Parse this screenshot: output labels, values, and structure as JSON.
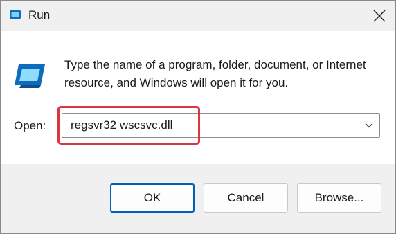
{
  "window": {
    "title": "Run",
    "title_icon": "run-icon",
    "close_icon": "close-icon"
  },
  "content": {
    "icon": "run-icon",
    "description": "Type the name of a program, folder, document, or Internet resource, and Windows will open it for you.",
    "open_label": "Open:",
    "open_value": "regsvr32 wscsvc.dll",
    "dropdown_icon": "chevron-down-icon"
  },
  "buttons": {
    "ok": "OK",
    "cancel": "Cancel",
    "browse": "Browse..."
  },
  "colors": {
    "highlight": "#d9363e",
    "accent": "#005fb8",
    "titlebar_bg": "#f0f0f0",
    "footer_bg": "#f0f0f0"
  }
}
